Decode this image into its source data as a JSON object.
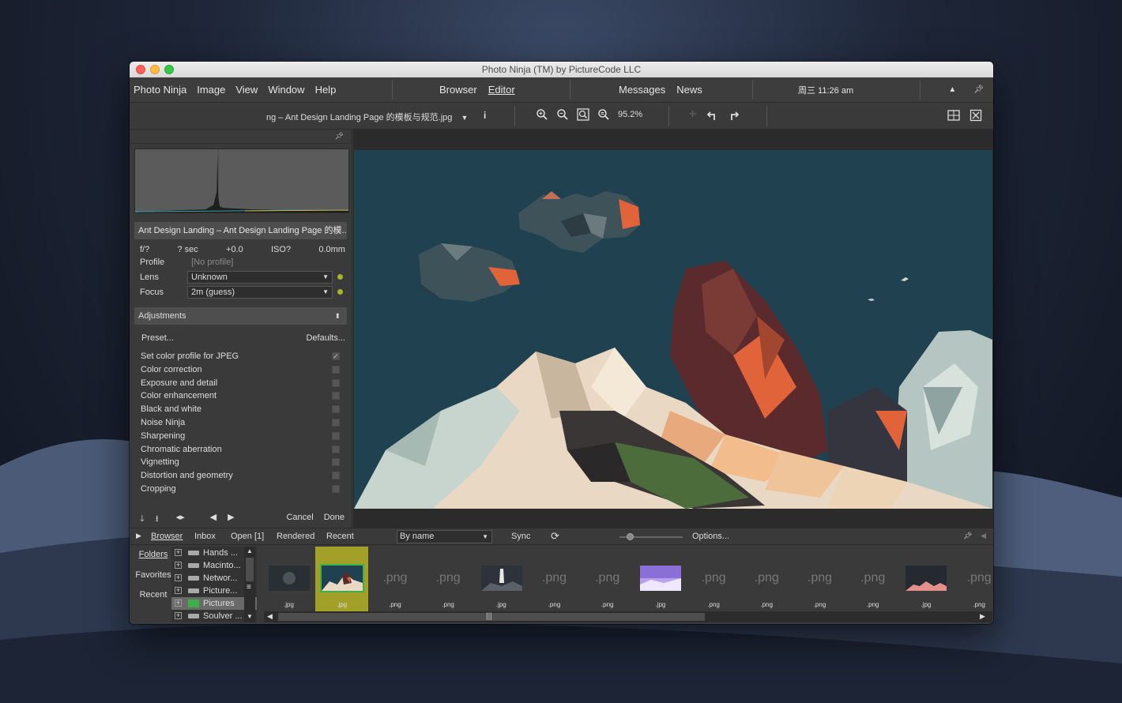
{
  "window": {
    "title": "Photo Ninja (TM) by PictureCode LLC"
  },
  "menubar": {
    "left_items": [
      "Photo Ninja",
      "Image",
      "View",
      "Window",
      "Help"
    ],
    "center_items": [
      "Browser",
      "Editor"
    ],
    "active_item": "Editor",
    "right_items": [
      "Messages",
      "News"
    ],
    "clock": "周三 11:26 am"
  },
  "toolbar": {
    "filename": "ng – Ant Design Landing Page 的模板与规范.jpg",
    "zoom": "95.2%"
  },
  "left_panel": {
    "file_title": "Ant Design Landing – Ant Design Landing Page 的模...",
    "exif": {
      "aperture": "f/?",
      "shutter": "? sec",
      "ev": "+0.0",
      "iso": "ISO?",
      "focal": "0.0mm"
    },
    "profile_label": "Profile",
    "profile_value": "[No profile]",
    "lens_label": "Lens",
    "lens_value": "Unknown",
    "focus_label": "Focus",
    "focus_value": "2m (guess)",
    "adjustments_label": "Adjustments",
    "preset_label": "Preset...",
    "defaults_label": "Defaults...",
    "adjustments": [
      {
        "label": "Set color profile for JPEG",
        "checked": true
      },
      {
        "label": "Color correction",
        "checked": false
      },
      {
        "label": "Exposure and detail",
        "checked": false
      },
      {
        "label": "Color enhancement",
        "checked": false
      },
      {
        "label": "Black and white",
        "checked": false
      },
      {
        "label": "Noise Ninja",
        "checked": false
      },
      {
        "label": "Sharpening",
        "checked": false
      },
      {
        "label": "Chromatic aberration",
        "checked": false
      },
      {
        "label": "Vignetting",
        "checked": false
      },
      {
        "label": "Distortion and geometry",
        "checked": false
      },
      {
        "label": "Cropping",
        "checked": false
      }
    ],
    "cancel_label": "Cancel",
    "done_label": "Done"
  },
  "browser_bar": {
    "tabs": [
      "Browser",
      "Inbox",
      "Open [1]",
      "Rendered",
      "Recent"
    ],
    "sort": "By name",
    "sync_label": "Sync",
    "options_label": "Options..."
  },
  "bottom": {
    "nav": [
      "Folders",
      "Favorites",
      "Recent"
    ],
    "tree": [
      {
        "label": "Hands ...",
        "kind": "drive"
      },
      {
        "label": "Macinto...",
        "kind": "drive"
      },
      {
        "label": "Networ...",
        "kind": "drive"
      },
      {
        "label": "Picture...",
        "kind": "drive"
      },
      {
        "label": "Pictures",
        "kind": "folder"
      },
      {
        "label": "Soulver ...",
        "kind": "drive"
      }
    ],
    "selected_tree_item": "Pictures",
    "thumbnails": [
      {
        "caption": ".jpg",
        "kind": "dark"
      },
      {
        "caption": ".jpg",
        "kind": "landscape",
        "selected": true
      },
      {
        "caption": ".png",
        "kind": "placeholder"
      },
      {
        "caption": ".png",
        "kind": "placeholder"
      },
      {
        "caption": ".jpg",
        "kind": "rocket"
      },
      {
        "caption": ".png",
        "kind": "placeholder"
      },
      {
        "caption": ".png",
        "kind": "placeholder"
      },
      {
        "caption": ".jpg",
        "kind": "purple"
      },
      {
        "caption": ".png",
        "kind": "placeholder"
      },
      {
        "caption": ".png",
        "kind": "placeholder"
      },
      {
        "caption": ".png",
        "kind": "placeholder"
      },
      {
        "caption": ".png",
        "kind": "placeholder"
      },
      {
        "caption": ".jpg",
        "kind": "mountain"
      },
      {
        "caption": ".png",
        "kind": "placeholder"
      }
    ],
    "placeholder_text": ".png"
  },
  "colors": {
    "accent_green": "#3cb04a",
    "selection_yellow": "#a3a02a",
    "sky": "#1f4150"
  }
}
